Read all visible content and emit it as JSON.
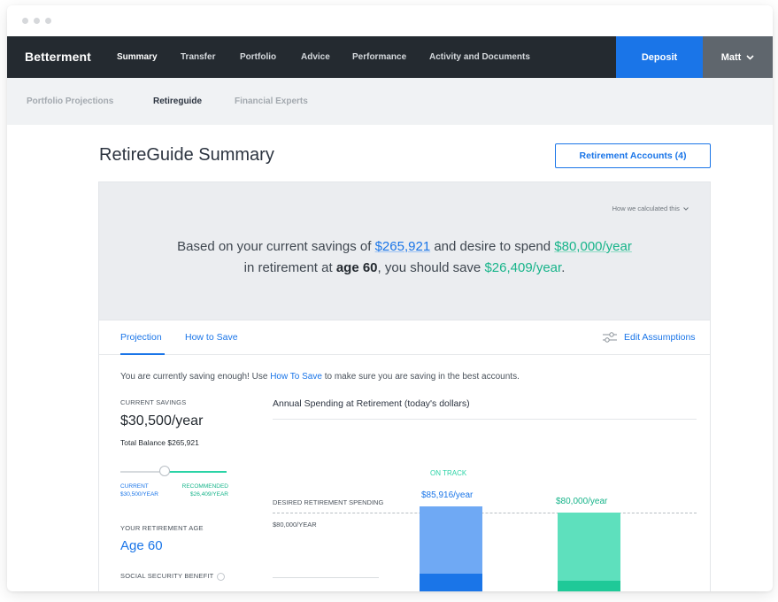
{
  "brand": {
    "name": "Betterment"
  },
  "nav": {
    "items": [
      {
        "label": "Summary",
        "active": true
      },
      {
        "label": "Transfer"
      },
      {
        "label": "Portfolio"
      },
      {
        "label": "Advice"
      },
      {
        "label": "Performance"
      },
      {
        "label": "Activity and Documents"
      }
    ],
    "deposit_label": "Deposit",
    "user_name": "Matt"
  },
  "subnav": {
    "items": [
      {
        "label": "Portfolio Projections"
      },
      {
        "label": "Retireguide",
        "active": true
      },
      {
        "label": "Financial Experts"
      }
    ]
  },
  "page": {
    "title": "RetireGuide Summary",
    "accounts_button": "Retirement Accounts (4)"
  },
  "summary": {
    "how_calculated": "How we calculated this",
    "p1": "Based on your current savings of",
    "savings": "$265,921",
    "p2": "and desire to spend",
    "spend": "$80,000/year",
    "p3": "in retirement at",
    "age": "age 60",
    "p4": ", you should save",
    "should_save": "$26,409/year",
    "p5": "."
  },
  "tabs": {
    "projection": "Projection",
    "how_to_save": "How to Save",
    "edit_assumptions": "Edit Assumptions"
  },
  "message": {
    "before": "You are currently saving enough! Use",
    "link": "How To Save",
    "after": "to make sure you are saving in the best accounts."
  },
  "left": {
    "current_savings_label": "CURRENT SAVINGS",
    "current_savings_value": "$30,500/year",
    "total_balance": "Total Balance $265,921",
    "slider_current_label": "CURRENT",
    "slider_current_value": "$30,500/YEAR",
    "slider_recommended_label": "RECOMMENDED",
    "slider_recommended_value": "$26,409/YEAR",
    "retirement_age_label": "YOUR RETIREMENT AGE",
    "retirement_age_value": "Age 60",
    "social_security_label": "SOCIAL SECURITY BENEFIT"
  },
  "chart_data": {
    "type": "bar",
    "title": "Annual Spending at Retirement (today's dollars)",
    "reference_line": {
      "label": "DESIRED RETIREMENT SPENDING",
      "value_label": "$80,000/YEAR",
      "value": 80000
    },
    "categories": [
      "",
      ""
    ],
    "values": [
      85916,
      80000
    ],
    "bar_labels": [
      "$85,916/year",
      "$80,000/year"
    ],
    "annotation": "ON TRACK",
    "colors": {
      "blue": "#6fa9f4",
      "blue_dark": "#1a75e8",
      "green": "#5ee0bd",
      "green_dark": "#1fc998"
    }
  },
  "colors": {
    "accent": "#1a75e8",
    "green": "#17b48a",
    "nav_bg": "#242a30"
  }
}
